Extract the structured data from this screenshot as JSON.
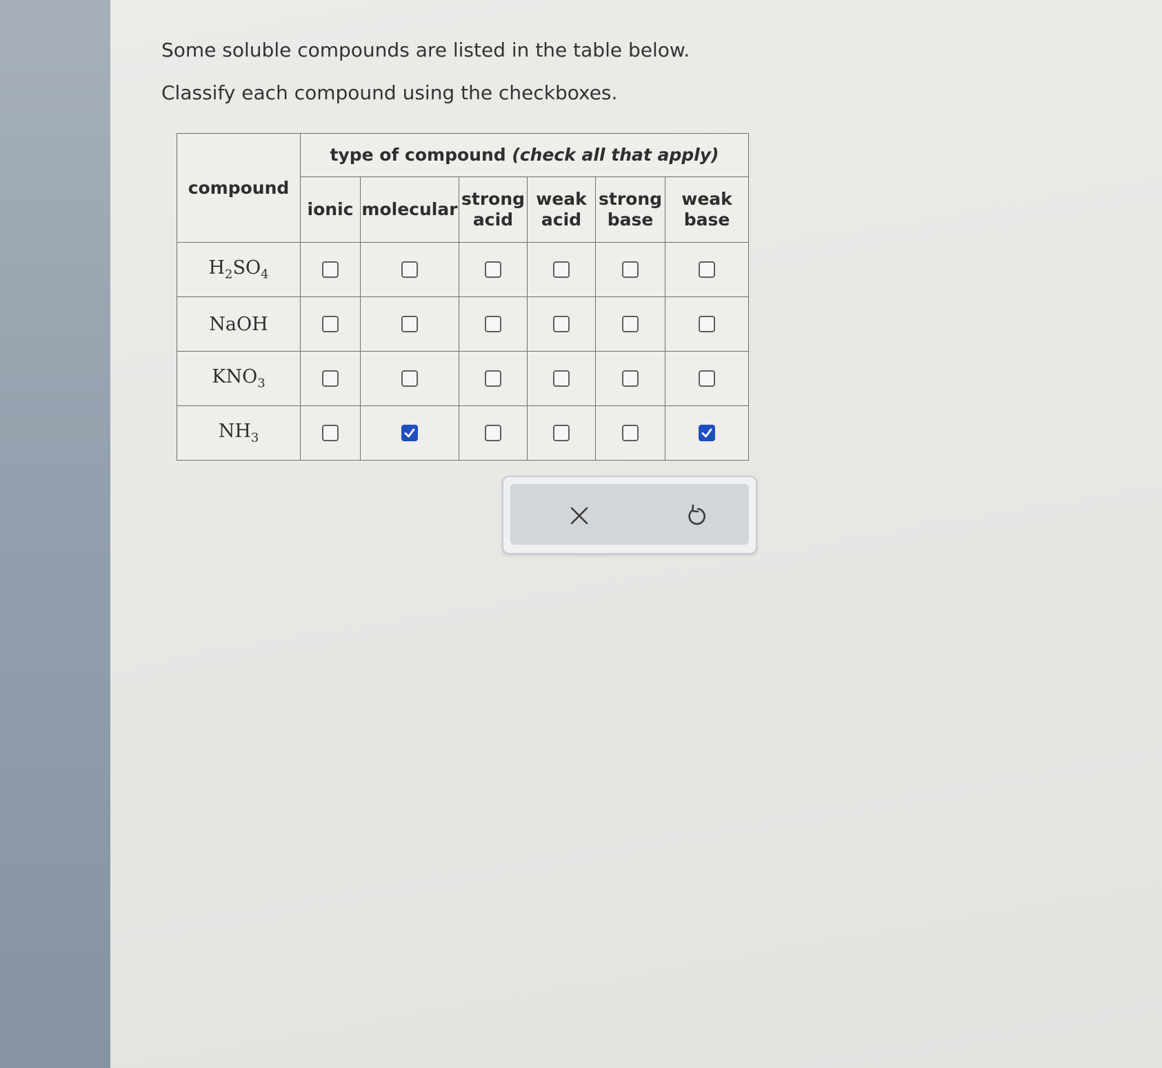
{
  "prompt": {
    "line1": "Some soluble compounds are listed in the table below.",
    "line2": "Classify each compound using the checkboxes."
  },
  "table": {
    "compound_header": "compound",
    "group_header_main": "type of compound",
    "group_header_note": "(check all that apply)",
    "columns": [
      "ionic",
      "molecular",
      "strong acid",
      "weak acid",
      "strong base",
      "weak base"
    ],
    "rows": [
      {
        "formula": "H2SO4",
        "checked": [
          false,
          false,
          false,
          false,
          false,
          false
        ]
      },
      {
        "formula": "NaOH",
        "checked": [
          false,
          false,
          false,
          false,
          false,
          false
        ]
      },
      {
        "formula": "KNO3",
        "checked": [
          false,
          false,
          false,
          false,
          false,
          false
        ]
      },
      {
        "formula": "NH3",
        "checked": [
          false,
          true,
          false,
          false,
          false,
          true
        ]
      }
    ]
  },
  "actions": {
    "clear_icon": "x-icon",
    "undo_icon": "undo-icon"
  },
  "colors": {
    "checkbox_checked": "#1f4fbf",
    "text": "#333333"
  }
}
